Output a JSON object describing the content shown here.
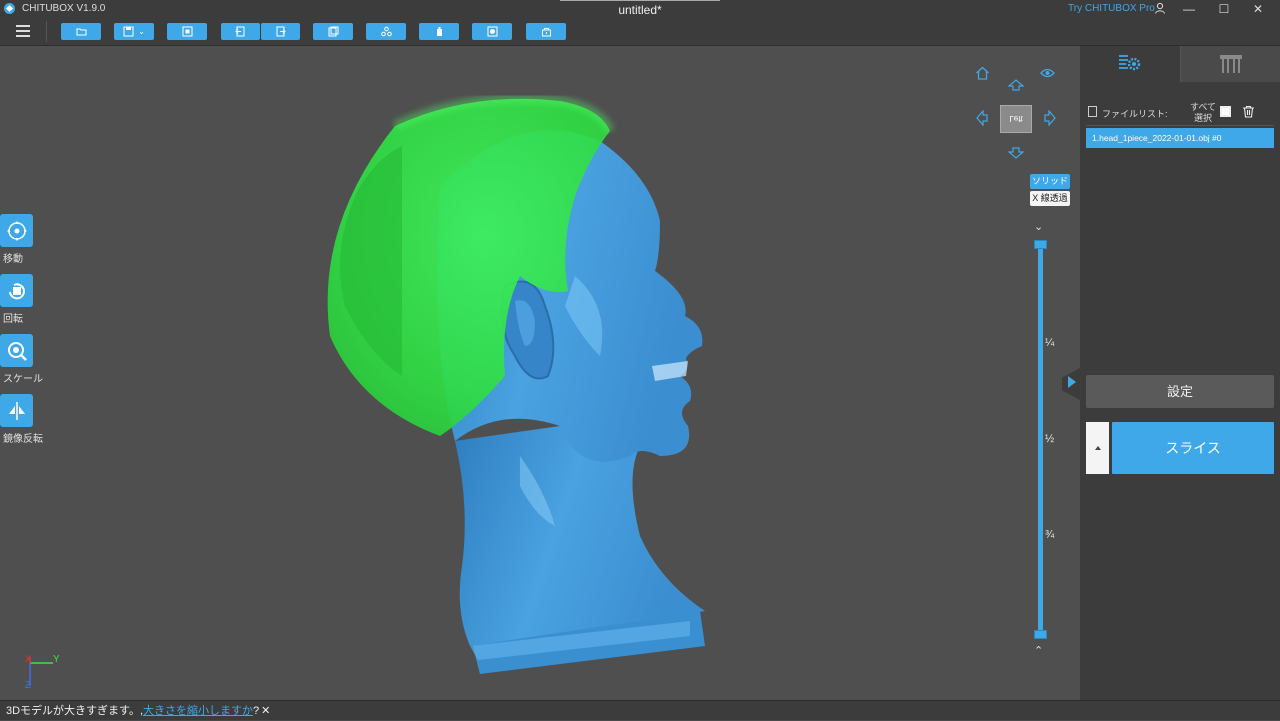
{
  "titlebar": {
    "app_name": "CHITUBOX V1.9.0",
    "doc_title": "untitled*",
    "try_pro": "Try CHITUBOX Pro",
    "minimize": "—",
    "maximize": "☐",
    "close": "✕"
  },
  "toolbar": {
    "buttons": [
      "open-file",
      "save",
      "import",
      "undo",
      "redo",
      "copy",
      "supports",
      "hollow",
      "scene",
      "settings"
    ]
  },
  "left_tools": [
    {
      "label": "移動",
      "icon": "move-icon"
    },
    {
      "label": "回転",
      "icon": "rotate-icon"
    },
    {
      "label": "スケール",
      "icon": "scale-icon"
    },
    {
      "label": "鏡像反転",
      "icon": "mirror-icon"
    }
  ],
  "view": {
    "cube_label": "Left",
    "solid_label": "ソリッド",
    "xray_label": "X 線透過",
    "slider_marks": [
      "¼",
      "½",
      "¾"
    ]
  },
  "axes": {
    "x": "X",
    "y": "Y",
    "z": "Z"
  },
  "colors": {
    "accent": "#3fa8e8",
    "model": "#3f8fd0",
    "selection_overlay": "#33e84a"
  },
  "panel": {
    "file_list_title": "ファイルリスト:",
    "select_all": "すべて選択",
    "files": [
      "1.head_1piece_2022-01-01.obj #0"
    ],
    "settings_label": "設定",
    "slice_label": "スライス"
  },
  "status": {
    "message": "3Dモデルが大きすぎます。,",
    "link_text": "大きさを縮小しますか",
    "suffix": "?",
    "close": "✕"
  }
}
